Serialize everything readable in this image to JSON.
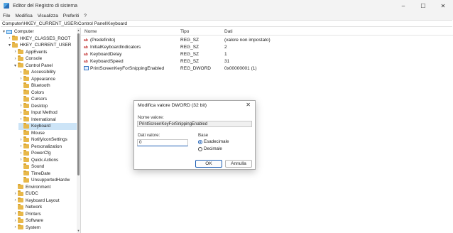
{
  "window": {
    "title": "Editor del Registro di sistema",
    "controls": [
      "–",
      "☐",
      "✕"
    ]
  },
  "menu": [
    "File",
    "Modifica",
    "Visualizza",
    "Preferiti",
    "?"
  ],
  "address": "Computer\\HKEY_CURRENT_USER\\Control Panel\\Keyboard",
  "tree": [
    {
      "label": "Computer",
      "chev": "▾",
      "icon": "computer"
    },
    {
      "label": "HKEY_CLASSES_ROOT",
      "chev": "›",
      "icon": "folder"
    },
    {
      "label": "HKEY_CURRENT_USER",
      "chev": "▾",
      "icon": "folder"
    },
    {
      "label": "AppEvents",
      "chev": "›",
      "icon": "folder"
    },
    {
      "label": "Console",
      "chev": "›",
      "icon": "folder"
    },
    {
      "label": "Control Panel",
      "chev": "▾",
      "icon": "folder"
    },
    {
      "label": "Accessibility",
      "chev": "›",
      "icon": "folder"
    },
    {
      "label": "Appearance",
      "chev": "›",
      "icon": "folder"
    },
    {
      "label": "Bluetooth",
      "chev": "",
      "icon": "folder"
    },
    {
      "label": "Colors",
      "chev": "",
      "icon": "folder"
    },
    {
      "label": "Cursors",
      "chev": "",
      "icon": "folder"
    },
    {
      "label": "Desktop",
      "chev": "›",
      "icon": "folder"
    },
    {
      "label": "Input Method",
      "chev": "›",
      "icon": "folder"
    },
    {
      "label": "International",
      "chev": "›",
      "icon": "folder"
    },
    {
      "label": "Keyboard",
      "chev": "",
      "icon": "folder"
    },
    {
      "label": "Mouse",
      "chev": "",
      "icon": "folder"
    },
    {
      "label": "NotifyIconSettings",
      "chev": "›",
      "icon": "folder"
    },
    {
      "label": "Personalization",
      "chev": "›",
      "icon": "folder"
    },
    {
      "label": "PowerCfg",
      "chev": "›",
      "icon": "folder"
    },
    {
      "label": "Quick Actions",
      "chev": "›",
      "icon": "folder"
    },
    {
      "label": "Sound",
      "chev": "",
      "icon": "folder"
    },
    {
      "label": "TimeDate",
      "chev": "",
      "icon": "folder"
    },
    {
      "label": "UnsupportedHardw",
      "chev": "",
      "icon": "folder"
    },
    {
      "label": "Environment",
      "chev": "",
      "icon": "folder"
    },
    {
      "label": "EUDC",
      "chev": "›",
      "icon": "folder"
    },
    {
      "label": "Keyboard Layout",
      "chev": "›",
      "icon": "folder"
    },
    {
      "label": "Network",
      "chev": "",
      "icon": "folder"
    },
    {
      "label": "Printers",
      "chev": "›",
      "icon": "folder"
    },
    {
      "label": "Software",
      "chev": "›",
      "icon": "folder"
    },
    {
      "label": "System",
      "chev": "›",
      "icon": "folder"
    }
  ],
  "selected_tree_item": "Keyboard",
  "columns": {
    "name": "Nome",
    "type": "Tipo",
    "data": "Dati"
  },
  "rows": [
    {
      "name": "(Predefinito)",
      "type": "REG_SZ",
      "data": "(valore non impostato)",
      "icon": "string-value-icon"
    },
    {
      "name": "InitialKeyboardIndicators",
      "type": "REG_SZ",
      "data": "2",
      "icon": "string-value-icon"
    },
    {
      "name": "KeyboardDelay",
      "type": "REG_SZ",
      "data": "1",
      "icon": "string-value-icon"
    },
    {
      "name": "KeyboardSpeed",
      "type": "REG_SZ",
      "data": "31",
      "icon": "string-value-icon"
    },
    {
      "name": "PrintScreenKeyForSnippingEnabled",
      "type": "REG_DWORD",
      "data": "0x00000001 (1)",
      "icon": "binary-value-icon"
    }
  ],
  "dialog": {
    "title": "Modifica valore DWORD (32 bit)",
    "close": "✕",
    "name_label": "Nome valore:",
    "name_value": "PrintScreenKeyForSnippingEnabled",
    "data_label": "Dati valore:",
    "data_value": "0",
    "base_label": "Base",
    "hex_label": "Esadecimale",
    "dec_label": "Decimale",
    "base_selected": "hex",
    "ok": "OK",
    "cancel": "Annulla"
  },
  "colors": {
    "selection": "#cce4f7",
    "accent": "#1e5fb4",
    "folder": "#e8b84a"
  }
}
